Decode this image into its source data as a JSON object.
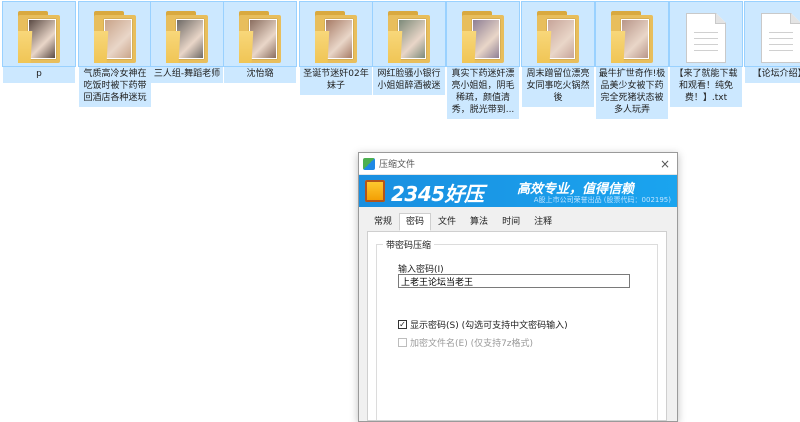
{
  "files": [
    {
      "label": "p",
      "type": "folder",
      "photo": "#5a4a44",
      "selected": true
    },
    {
      "label": "气质高冷女神在吃饭时被下药带回酒店各种迷玩",
      "type": "folder",
      "photo": "#c9a48a",
      "selected": true
    },
    {
      "label": "三人组-舞蹈老师",
      "type": "folder",
      "photo": "#6e6a66",
      "selected": true
    },
    {
      "label": "沈怡璐",
      "type": "folder",
      "photo": "#8a6e60",
      "selected": true
    },
    {
      "label": "圣诞节迷奸02年妹子",
      "type": "folder",
      "photo": "#a77b66",
      "selected": true
    },
    {
      "label": "网红脸骚小银行小姐姐醉酒被迷",
      "type": "folder",
      "photo": "#7c8a7a",
      "selected": true
    },
    {
      "label": "真实下药迷奸漂亮小姐姐，阴毛稀疏，颜值清秀，脱光带到...",
      "type": "folder",
      "photo": "#8e7f95",
      "selected": true
    },
    {
      "label": "周末蹭留位漂亮女同事吃火锅然後",
      "type": "folder",
      "photo": "#c7a59a",
      "selected": true
    },
    {
      "label": "最牛扩世奇作!极品美少女被下药完全死猪状态被多人玩弄",
      "type": "folder",
      "photo": "#b8968a",
      "selected": true
    },
    {
      "label": "【来了就能下载和观看！纯免费！】.txt",
      "type": "doc",
      "selected": true
    },
    {
      "label": "【论坛介绍】.",
      "type": "doc",
      "selected": true
    }
  ],
  "dialog": {
    "title": "压缩文件",
    "brand": "2345好压",
    "slogan": "高效专业，值得信赖",
    "sub": "A股上市公司荣誉出品 (股票代码：002195)",
    "close_icon": "×",
    "tabs": [
      "常规",
      "密码",
      "文件",
      "算法",
      "时间",
      "注释"
    ],
    "active_tab": 1,
    "group_title": "带密码压缩",
    "password_label": "输入密码(I)",
    "password_value": "上老王论坛当老王",
    "show_password": {
      "label": "显示密码(S)  (勾选可支持中文密码输入)",
      "checked": true,
      "check_glyph": "✓"
    },
    "encrypt_names": {
      "label": "加密文件名(E)  (仅支持7z格式)",
      "checked": false,
      "enabled": false
    }
  }
}
